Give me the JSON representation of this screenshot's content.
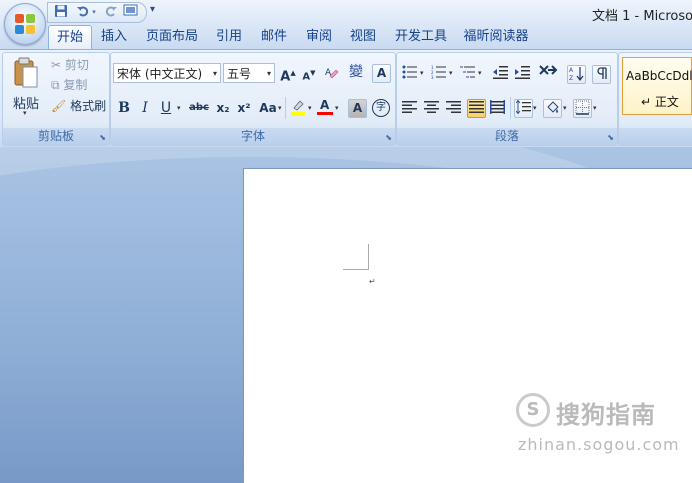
{
  "titlebar": {
    "doc_title": "文档 1 - Microsof",
    "qat": [
      "save-icon",
      "undo-icon",
      "redo-icon",
      "print-preview-icon"
    ]
  },
  "tabs": [
    {
      "label": "开始",
      "active": true
    },
    {
      "label": "插入"
    },
    {
      "label": "页面布局"
    },
    {
      "label": "引用"
    },
    {
      "label": "邮件"
    },
    {
      "label": "审阅"
    },
    {
      "label": "视图"
    },
    {
      "label": "开发工具"
    },
    {
      "label": "福昕阅读器"
    }
  ],
  "clipboard": {
    "paste": "粘贴",
    "cut": "剪切",
    "copy": "复制",
    "format_painter": "格式刷",
    "label": "剪贴板"
  },
  "font": {
    "font_name": "宋体 (中文正文)",
    "font_size": "五号",
    "grow": "A",
    "shrink": "A",
    "clear": "A",
    "bold": "B",
    "italic": "I",
    "underline": "U",
    "strike": "abc",
    "subscript": "x₂",
    "superscript": "x²",
    "change_case": "Aa",
    "font_color": "A",
    "char_shading": "A",
    "char_border": "A",
    "enclose": "字",
    "phonetic": "變",
    "label": "字体",
    "highlight_color": "#ffff00",
    "font_color_value": "#ff0000"
  },
  "paragraph": {
    "label": "段落"
  },
  "styles": {
    "sample": "AaBbCcDdl",
    "name": "↵ 正文"
  },
  "document": {
    "para_mark": "↵"
  },
  "watermark": {
    "logo_letter": "S",
    "brand": "搜狗指南",
    "url": "zhinan.sogou.com"
  }
}
